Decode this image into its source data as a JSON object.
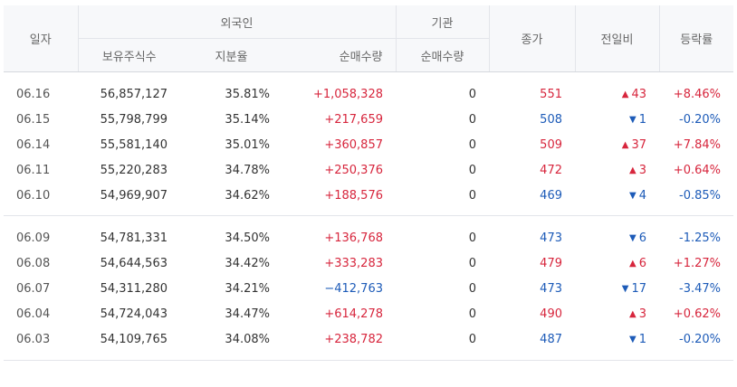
{
  "header": {
    "date": "일자",
    "foreign": "외국인",
    "institution": "기관",
    "close": "종가",
    "change": "전일비",
    "rate": "등락률",
    "holdings": "보유주식수",
    "ratio": "지분율",
    "net_foreign": "순매수량",
    "net_inst": "순매수량"
  },
  "colors": {
    "up": "#d7263d",
    "down": "#1d5bb8"
  },
  "groups": [
    {
      "rows": [
        {
          "date": "06.16",
          "holdings": "56,857,127",
          "ratio": "35.81%",
          "net_foreign": "+1,058,328",
          "net_inst": "0",
          "close": "551",
          "dir": "up",
          "change": "43",
          "rate": "+8.46%"
        },
        {
          "date": "06.15",
          "holdings": "55,798,799",
          "ratio": "35.14%",
          "net_foreign": "+217,659",
          "net_inst": "0",
          "close": "508",
          "dir": "down",
          "change": "1",
          "rate": "-0.20%"
        },
        {
          "date": "06.14",
          "holdings": "55,581,140",
          "ratio": "35.01%",
          "net_foreign": "+360,857",
          "net_inst": "0",
          "close": "509",
          "dir": "up",
          "change": "37",
          "rate": "+7.84%"
        },
        {
          "date": "06.11",
          "holdings": "55,220,283",
          "ratio": "34.78%",
          "net_foreign": "+250,376",
          "net_inst": "0",
          "close": "472",
          "dir": "up",
          "change": "3",
          "rate": "+0.64%"
        },
        {
          "date": "06.10",
          "holdings": "54,969,907",
          "ratio": "34.62%",
          "net_foreign": "+188,576",
          "net_inst": "0",
          "close": "469",
          "dir": "down",
          "change": "4",
          "rate": "-0.85%"
        }
      ]
    },
    {
      "rows": [
        {
          "date": "06.09",
          "holdings": "54,781,331",
          "ratio": "34.50%",
          "net_foreign": "+136,768",
          "net_inst": "0",
          "close": "473",
          "dir": "down",
          "change": "6",
          "rate": "-1.25%"
        },
        {
          "date": "06.08",
          "holdings": "54,644,563",
          "ratio": "34.42%",
          "net_foreign": "+333,283",
          "net_inst": "0",
          "close": "479",
          "dir": "up",
          "change": "6",
          "rate": "+1.27%"
        },
        {
          "date": "06.07",
          "holdings": "54,311,280",
          "ratio": "34.21%",
          "net_foreign": "−412,763",
          "net_inst": "0",
          "close": "473",
          "dir": "down",
          "change": "17",
          "rate": "-3.47%"
        },
        {
          "date": "06.04",
          "holdings": "54,724,043",
          "ratio": "34.47%",
          "net_foreign": "+614,278",
          "net_inst": "0",
          "close": "490",
          "dir": "up",
          "change": "3",
          "rate": "+0.62%"
        },
        {
          "date": "06.03",
          "holdings": "54,109,765",
          "ratio": "34.08%",
          "net_foreign": "+238,782",
          "net_inst": "0",
          "close": "487",
          "dir": "down",
          "change": "1",
          "rate": "-0.20%"
        }
      ]
    }
  ]
}
